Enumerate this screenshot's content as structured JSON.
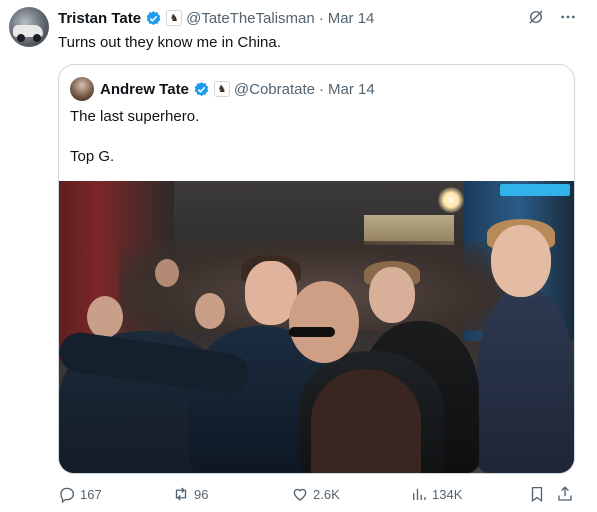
{
  "tweet": {
    "author_name": "Tristan Tate",
    "handle": "@TateTheTalisman",
    "separator": "·",
    "date": "Mar 14",
    "text": "Turns out they know me in China."
  },
  "quoted": {
    "author_name": "Andrew Tate",
    "handle": "@Cobratate",
    "separator": "·",
    "date": "Mar 14",
    "text_line1": "The last superhero.",
    "text_line2": "Top G."
  },
  "actions": {
    "replies": "167",
    "retweets": "96",
    "likes": "2.6K",
    "views": "134K"
  },
  "icons": {
    "verified": "verified-badge-icon",
    "grok": "grok-icon",
    "more": "more-icon",
    "reply": "reply-icon",
    "retweet": "retweet-icon",
    "like": "heart-icon",
    "views": "views-icon",
    "bookmark": "bookmark-icon",
    "share": "share-icon"
  },
  "colors": {
    "verified_blue": "#1d9bf0",
    "secondary_text": "#536471",
    "primary_text": "#0f1419",
    "border": "#cfd9de"
  }
}
